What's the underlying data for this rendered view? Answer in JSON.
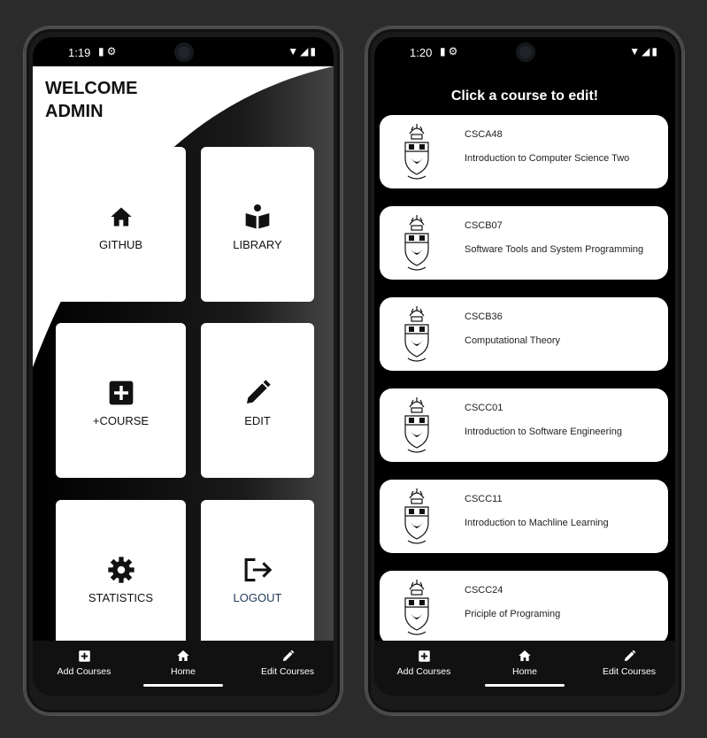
{
  "left_screen": {
    "status": {
      "time": "1:19"
    },
    "welcome": {
      "line1": "WELCOME",
      "line2": "ADMIN"
    },
    "tiles": [
      {
        "label": "GITHUB",
        "icon": "home-icon"
      },
      {
        "label": "LIBRARY",
        "icon": "book-reader-icon"
      },
      {
        "label": "+COURSE",
        "icon": "plus-box-icon"
      },
      {
        "label": "EDIT",
        "icon": "pencil-icon"
      },
      {
        "label": "STATISTICS",
        "icon": "gear-icon"
      },
      {
        "label": "LOGOUT",
        "icon": "logout-icon",
        "label_color": "#1f3a5a"
      }
    ]
  },
  "right_screen": {
    "status": {
      "time": "1:20"
    },
    "title": "Click a course to edit!",
    "courses": [
      {
        "code": "CSCA48",
        "name": "Introduction to Computer Science Two"
      },
      {
        "code": "CSCB07",
        "name": "Software Tools and System Programming"
      },
      {
        "code": "CSCB36",
        "name": "Computational Theory"
      },
      {
        "code": "CSCC01",
        "name": "Introduction to Software Engineering"
      },
      {
        "code": "CSCC11",
        "name": "Introduction to Machline Learning"
      },
      {
        "code": "CSCC24",
        "name": "Priciple of Programing"
      }
    ]
  },
  "bottom_nav": [
    {
      "label": "Add Courses",
      "icon": "plus-box-icon"
    },
    {
      "label": "Home",
      "icon": "home-icon"
    },
    {
      "label": "Edit Courses",
      "icon": "pencil-icon"
    }
  ]
}
